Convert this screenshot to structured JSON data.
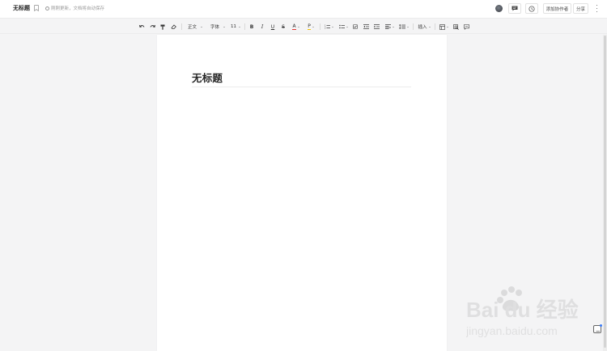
{
  "header": {
    "doc_title": "无标题",
    "save_status": "刚刚更新，文档将自动保存",
    "comment_icon": "comment-icon",
    "history_icon": "history-icon",
    "collab_label": "添加协作者",
    "share_label": "分享",
    "more_icon": "more-vertical-icon"
  },
  "toolbar": {
    "undo_icon": "undo-icon",
    "redo_icon": "redo-icon",
    "format_painter_icon": "format-painter-icon",
    "clear_format_icon": "eraser-icon",
    "style_label": "正文",
    "font_label": "字体",
    "size_label": "11",
    "bold_label": "B",
    "italic_label": "I",
    "underline_label": "U",
    "strike_label": "S",
    "font_color_label": "A",
    "highlight_label": "P",
    "insert_label": "插入"
  },
  "editor": {
    "title": "无标题"
  },
  "watermark": {
    "brand": "Bai du 经验",
    "url": "jingyan.baidu.com"
  },
  "colors": {
    "background": "#f4f4f5",
    "page": "#ffffff",
    "font_color_accent": "#e53935",
    "highlight_accent": "#f5c400",
    "badge_blue": "#3a7bf7"
  }
}
